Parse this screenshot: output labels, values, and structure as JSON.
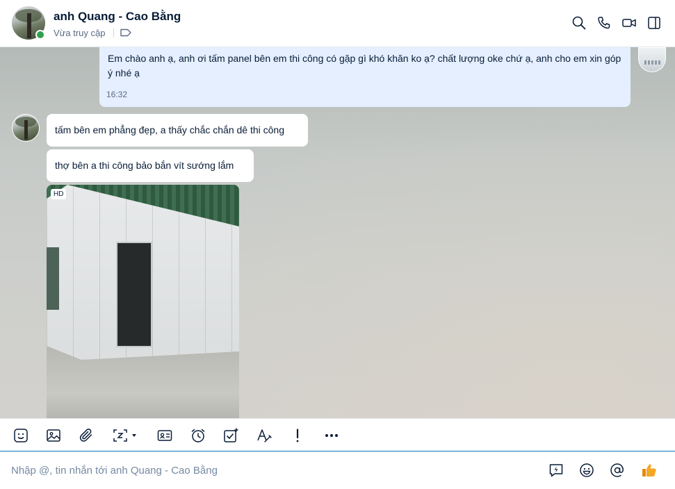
{
  "header": {
    "contact_name": "anh Quang - Cao Bằng",
    "status": "Vừa truy cập",
    "actions": [
      "search-icon",
      "phone-icon",
      "video-call-icon",
      "toggle-panel-icon"
    ]
  },
  "messages": {
    "outgoing": {
      "text": "Em chào anh ạ, anh ơi tấm panel bên em thi công có gặp gì khó khăn ko ạ? chất lượng oke chứ ạ, anh cho em xin góp ý nhé ạ",
      "time": "16:32"
    },
    "incoming": [
      {
        "text": "tấm bên em phẳng đẹp, a thấy chắc chắn dê thi công"
      },
      {
        "text": "thợ bên a thi công bảo bắn vít sướng lắm"
      }
    ],
    "photo": {
      "badge": "HD"
    }
  },
  "toolbar": {
    "items": [
      "sticker-icon",
      "image-icon",
      "attachment-icon",
      "screenshot-icon",
      "contact-card-icon",
      "reminder-icon",
      "task-icon",
      "text-format-icon",
      "urgent-icon",
      "more-icon"
    ]
  },
  "composer": {
    "placeholder": "Nhập @, tin nhắn tới anh Quang - Cao Bằng",
    "value": ""
  },
  "colors": {
    "accent": "#0a73c2",
    "online": "#30a14e",
    "outgoing_bubble": "#e5efff",
    "thumb": "#f5a623"
  }
}
